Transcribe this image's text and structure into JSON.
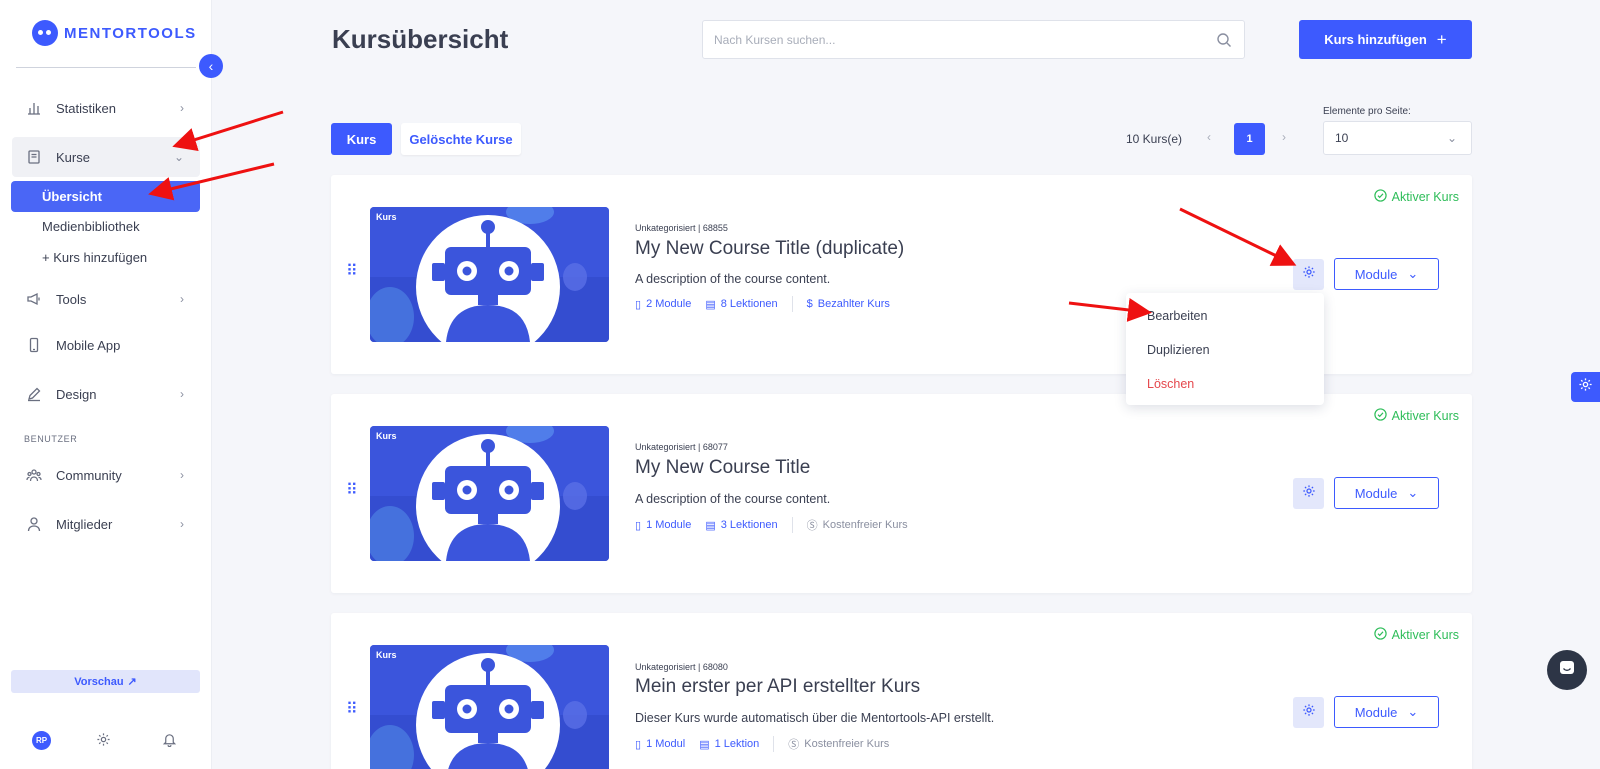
{
  "brand": {
    "name": "MENTORTOOLS"
  },
  "sidebar": {
    "items": [
      {
        "label": "Statistiken",
        "icon": "bar-chart-icon"
      },
      {
        "label": "Kurse",
        "icon": "book-icon"
      },
      {
        "label": "Tools",
        "icon": "megaphone-icon"
      },
      {
        "label": "Mobile App",
        "icon": "phone-icon"
      },
      {
        "label": "Design",
        "icon": "pencil-icon"
      },
      {
        "label": "Community",
        "icon": "users-icon"
      },
      {
        "label": "Mitglieder",
        "icon": "user-icon"
      }
    ],
    "sub_items": [
      "Übersicht",
      "Medienbibliothek",
      "+ Kurs hinzufügen"
    ],
    "section_label": "BENUTZER",
    "preview_label": "Vorschau",
    "avatar_initials": "RP"
  },
  "header": {
    "title": "Kursübersicht",
    "search_placeholder": "Nach Kursen suchen...",
    "add_button": "Kurs hinzufügen"
  },
  "toolbar": {
    "tab_active": "Kurs",
    "tab_deleted": "Gelöschte Kurse",
    "count": "10 Kurs(e)",
    "page": "1",
    "per_page_label": "Elemente pro Seite:",
    "per_page_value": "10"
  },
  "courses": [
    {
      "tag": "Kurs",
      "meta": "Unkategorisiert | 68855",
      "title": "My New Course Title (duplicate)",
      "description": "A description of the course content.",
      "modules": "2 Module",
      "lessons": "8 Lektionen",
      "pricing": "Bezahlter Kurs",
      "paid": true,
      "status": "Aktiver Kurs",
      "module_button": "Module"
    },
    {
      "tag": "Kurs",
      "meta": "Unkategorisiert | 68077",
      "title": "My New Course Title",
      "description": "A description of the course content.",
      "modules": "1 Module",
      "lessons": "3 Lektionen",
      "pricing": "Kostenfreier Kurs",
      "paid": false,
      "status": "Aktiver Kurs",
      "module_button": "Module"
    },
    {
      "tag": "Kurs",
      "meta": "Unkategorisiert | 68080",
      "title": "Mein erster per API erstellter Kurs",
      "description": "Dieser Kurs wurde automatisch über die Mentortools-API erstellt.",
      "modules": "1 Modul",
      "lessons": "1 Lektion",
      "pricing": "Kostenfreier Kurs",
      "paid": false,
      "status": "Aktiver Kurs",
      "module_button": "Module"
    }
  ],
  "dropdown": {
    "items": [
      "Bearbeiten",
      "Duplizieren",
      "Löschen"
    ]
  },
  "colors": {
    "primary": "#3d5afe",
    "success": "#2ebd59",
    "danger": "#e5484d",
    "annotation_arrow": "#ee1111"
  }
}
